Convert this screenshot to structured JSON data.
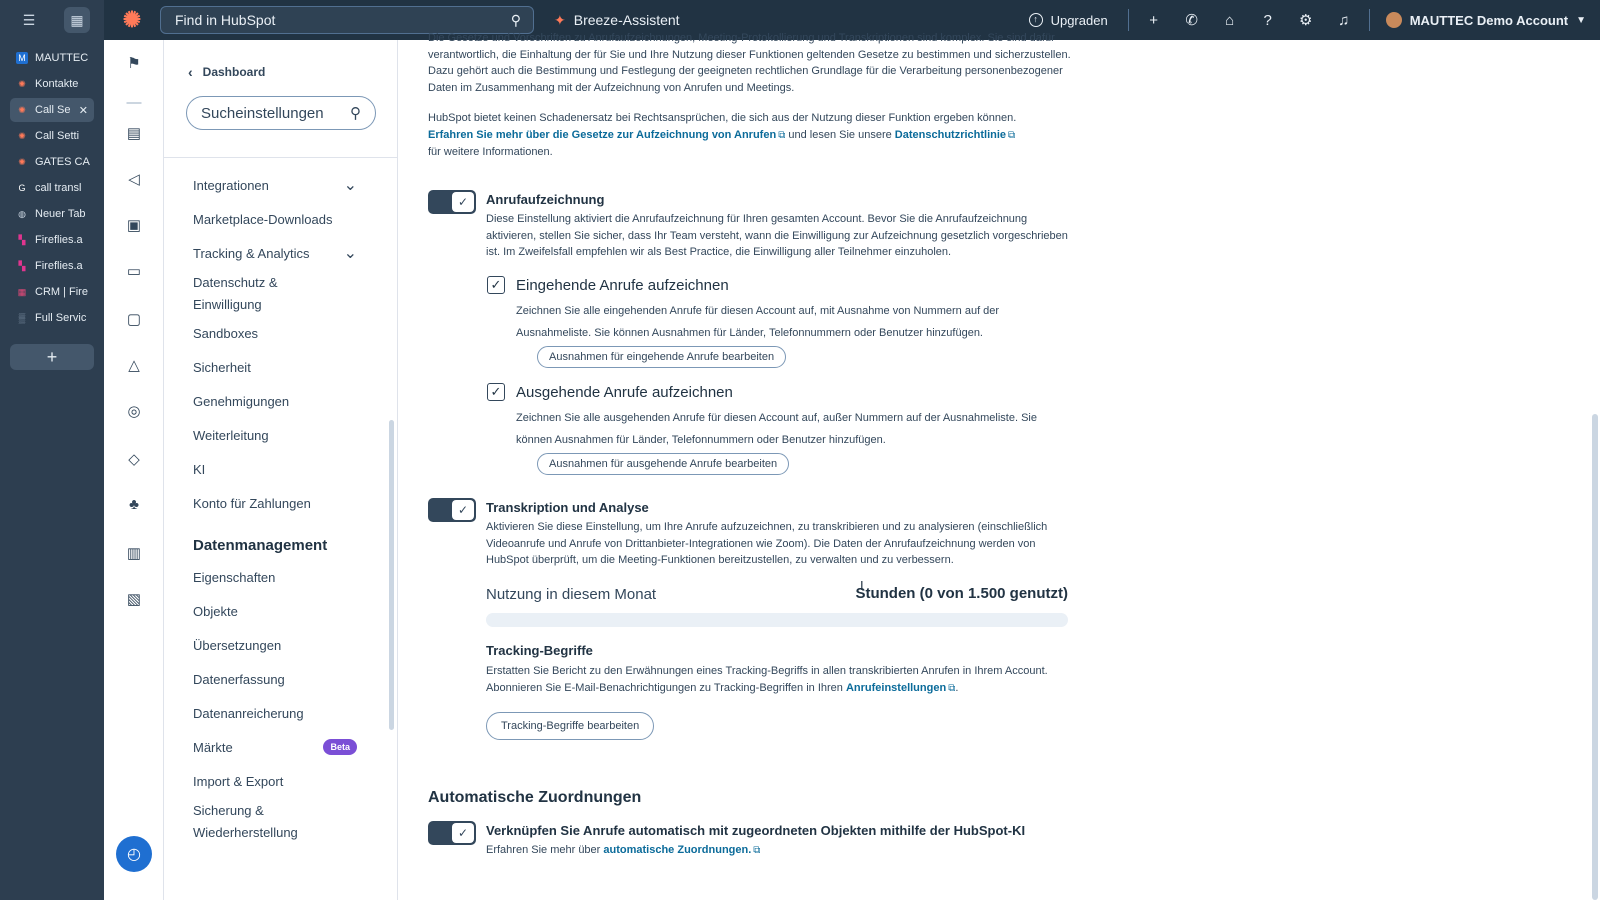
{
  "browser": {
    "tabs": [
      {
        "label": "MAUTTEC",
        "icon": "M",
        "color": "#1f6fd1",
        "active": false
      },
      {
        "label": "Kontakte",
        "icon": "hubspot-icon",
        "color": "#ff7a59",
        "active": false
      },
      {
        "label": "Call Se",
        "icon": "hubspot-icon",
        "color": "#ff7a59",
        "active": true
      },
      {
        "label": "Call Setti",
        "icon": "hubspot-icon",
        "color": "#ff7a59",
        "active": false
      },
      {
        "label": "GATES CA",
        "icon": "hubspot-icon",
        "color": "#ff7a59",
        "active": false
      },
      {
        "label": "call transl",
        "icon": "google-icon",
        "color": "#ffffff",
        "active": false
      },
      {
        "label": "Neuer Tab",
        "icon": "globe-icon",
        "color": "#cbd6e2",
        "active": false
      },
      {
        "label": "Fireflies.a",
        "icon": "fireflies-icon",
        "color": "#e0358f",
        "active": false
      },
      {
        "label": "Fireflies.a",
        "icon": "fireflies-icon",
        "color": "#e0358f",
        "active": false
      },
      {
        "label": "CRM | Fire",
        "icon": "crm-icon",
        "color": "#e84a7a",
        "active": false
      },
      {
        "label": "Full Servic",
        "icon": "grid-icon",
        "color": "#8fa3b8",
        "active": false
      }
    ],
    "close_glyph": "✕",
    "add_glyph": "+"
  },
  "topbar": {
    "search_placeholder": "Find in HubSpot",
    "breeze_label": "Breeze-Assistent",
    "upgrade_label": "Upgraden",
    "account_label": "MAUTTEC Demo Account"
  },
  "settings_nav": {
    "back_label": "Dashboard",
    "search_placeholder": "Sucheinstellungen",
    "items": [
      {
        "label": "Integrationen",
        "expandable": true
      },
      {
        "label": "Marketplace-Downloads"
      },
      {
        "label": "Tracking & Analytics",
        "expandable": true
      },
      {
        "label": "Datenschutz & Einwilligung",
        "two_line": true
      },
      {
        "label": "Sandboxes"
      },
      {
        "label": "Sicherheit"
      },
      {
        "label": "Genehmigungen"
      },
      {
        "label": "Weiterleitung"
      },
      {
        "label": "KI"
      },
      {
        "label": "Konto für Zahlungen"
      }
    ],
    "section_title": "Datenmanagement",
    "section_items": [
      {
        "label": "Eigenschaften"
      },
      {
        "label": "Objekte"
      },
      {
        "label": "Übersetzungen"
      },
      {
        "label": "Datenerfassung"
      },
      {
        "label": "Datenanreicherung"
      },
      {
        "label": "Märkte",
        "badge": "Beta"
      },
      {
        "label": "Import & Export"
      },
      {
        "label": "Sicherung & Wiederherstellung",
        "two_line": true
      }
    ]
  },
  "main": {
    "intro_top": "Die Gesetze und Vorschriften zu Anrufaufzeichnungen, Meeting-Protokollierung und Transkriptionen sind komplex. Sie sind dafür verantwortlich, die Einhaltung der für Sie und Ihre Nutzung dieser Funktionen geltenden Gesetze zu bestimmen und sicherzustellen. Dazu gehört auch die Bestimmung und Festlegung der geeigneten rechtlichen Grundlage für die Verarbeitung personenbezogener Daten im Zusammenhang mit der Aufzeichnung von Anrufen und Meetings.",
    "liability_text": "HubSpot bietet keinen Schadenersatz bei Rechtsansprüchen, die sich aus der Nutzung dieser Funktion ergeben können.",
    "laws_link": "Erfahren Sie mehr über die Gesetze zur Aufzeichnung von Anrufen",
    "and_read": " und lesen Sie unsere ",
    "privacy_link": "Datenschutzrichtlinie",
    "more_info": "für weitere Informationen.",
    "recording": {
      "title": "Anrufaufzeichnung",
      "desc": "Diese Einstellung aktiviert die Anrufaufzeichnung für Ihren gesamten Account. Bevor Sie die Anrufaufzeichnung aktivieren, stellen Sie sicher, dass Ihr Team versteht, wann die Einwilligung zur Aufzeichnung gesetzlich vorgeschrieben ist. Im Zweifelsfall empfehlen wir als Best Practice, die Einwilligung aller Teilnehmer einzuholen.",
      "inbound_title": "Eingehende Anrufe aufzeichnen",
      "inbound_desc": "Zeichnen Sie alle eingehenden Anrufe für diesen Account auf, mit Ausnahme von Nummern auf der Ausnahmeliste. Sie können Ausnahmen für Länder, Telefonnummern oder Benutzer hinzufügen.",
      "inbound_btn": "Ausnahmen für eingehende Anrufe bearbeiten",
      "outbound_title": "Ausgehende Anrufe aufzeichnen",
      "outbound_desc": "Zeichnen Sie alle ausgehenden Anrufe für diesen Account auf, außer Nummern auf der Ausnahmeliste. Sie können Ausnahmen für Länder, Telefonnummern oder Benutzer hinzufügen.",
      "outbound_btn": "Ausnahmen für ausgehende Anrufe bearbeiten"
    },
    "transcription": {
      "title": "Transkription und Analyse",
      "desc": "Aktivieren Sie diese Einstellung, um Ihre Anrufe aufzuzeichnen, zu transkribieren und zu analysieren (einschließlich Videoanrufe und Anrufe von Drittanbieter-Integrationen wie Zoom). Die Daten der Anrufaufzeichnung werden von HubSpot überprüft, um die Meeting-Funktionen bereitzustellen, zu verwalten und zu verbessern.",
      "usage_label": "Nutzung in diesem Monat",
      "usage_value": "Stunden (0 von 1.500 genutzt)",
      "usage_fraction": 0
    },
    "tracking_terms": {
      "title": "Tracking-Begriffe",
      "desc": "Erstatten Sie Bericht zu den Erwähnungen eines Tracking-Begriffs in allen transkribierten Anrufen in Ihrem Account. Abonnieren Sie E-Mail-Benachrichtigungen zu Tracking-Begriffen in Ihren ",
      "desc_link": "Anrufeinstellungen",
      "desc_end": ".",
      "btn": "Tracking-Begriffe bearbeiten"
    },
    "auto": {
      "section_title": "Automatische Zuordnungen",
      "title": "Verknüpfen Sie Anrufe automatisch mit zugeordneten Objekten mithilfe der HubSpot-KI",
      "desc": "Erfahren Sie mehr über ",
      "desc_link": "automatische Zuordnungen."
    }
  }
}
